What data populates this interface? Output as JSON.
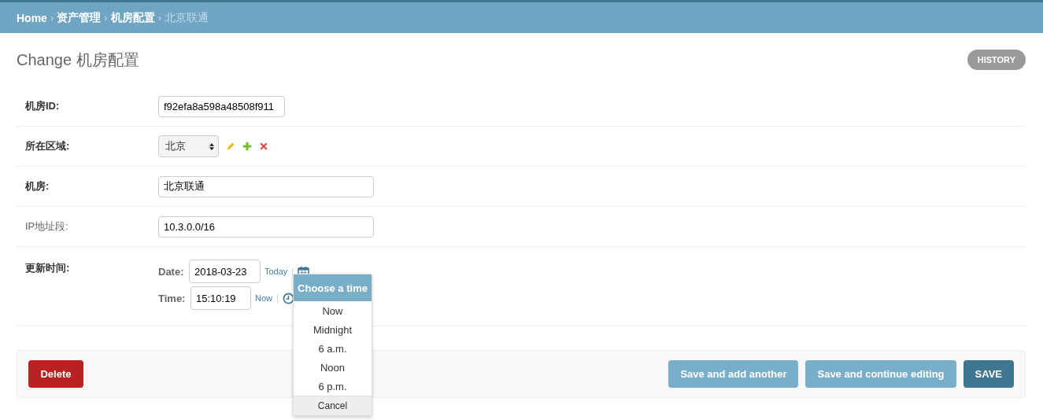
{
  "breadcrumb_separator": "›",
  "breadcrumbs": [
    {
      "label": "Home",
      "current": false
    },
    {
      "label": "资产管理",
      "current": false
    },
    {
      "label": "机房配置",
      "current": false
    },
    {
      "label": "北京联通",
      "current": true
    }
  ],
  "title": "Change 机房配置",
  "history_button": "HISTORY",
  "fields": [
    {
      "kind": "id",
      "label": "机房ID:",
      "required": true,
      "value": "f92efa8a598a48508f911"
    },
    {
      "kind": "select",
      "label": "所在区域:",
      "required": true,
      "value": "北京"
    },
    {
      "kind": "text",
      "label": "机房:",
      "required": true,
      "value": "北京联通"
    },
    {
      "kind": "text",
      "label": "IP地址段:",
      "required": false,
      "value": "10.3.0.0/16"
    },
    {
      "kind": "datetime",
      "label": "更新时间:",
      "required": true,
      "date_label": "Date:",
      "date": "2018-03-23",
      "today_link": "Today",
      "separator_1": "|",
      "time_label": "Time:",
      "time": "15:10:19",
      "now_link": "Now",
      "separator_2": "|"
    }
  ],
  "time_picker": {
    "title": "Choose a time",
    "options": [
      "Now",
      "Midnight",
      "6 a.m.",
      "Noon",
      "6 p.m."
    ],
    "cancel": "Cancel"
  },
  "submit_row": {
    "delete": "Delete",
    "buttons": [
      {
        "label": "Save and add another",
        "primary": false
      },
      {
        "label": "Save and continue editing",
        "primary": false
      },
      {
        "label": "SAVE",
        "primary": true
      }
    ]
  }
}
